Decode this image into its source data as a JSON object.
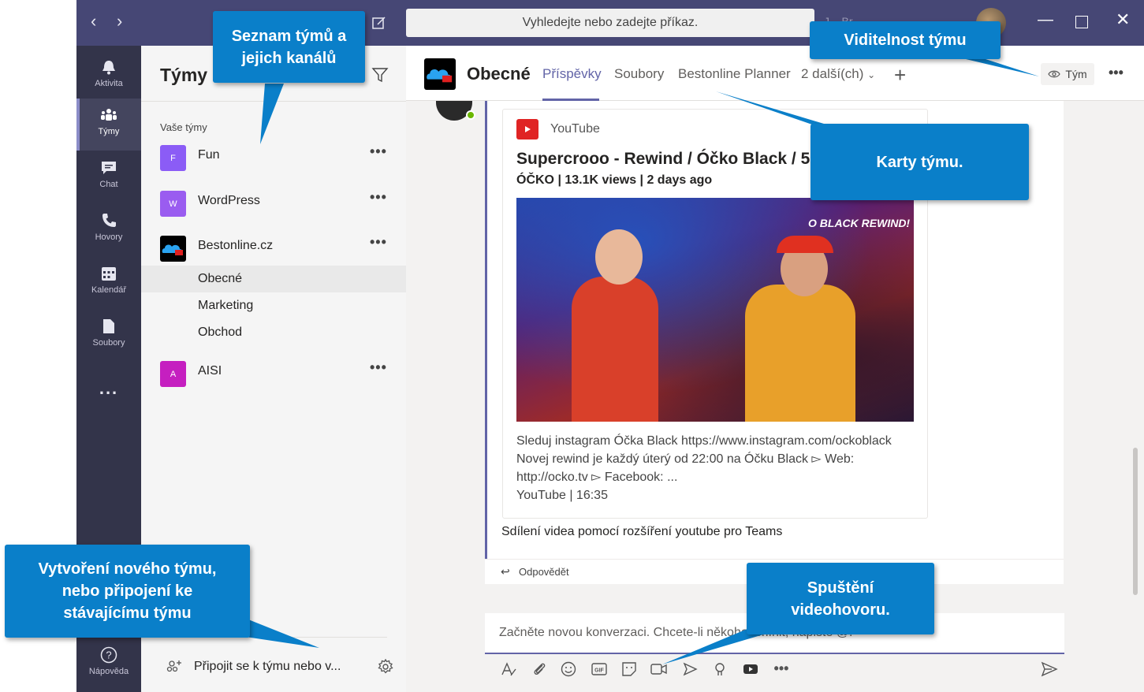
{
  "search": {
    "placeholder": "Vyhledejte nebo zadejte příkaz."
  },
  "titlebar": {
    "user_name": "J... Br..."
  },
  "rail": {
    "items": [
      {
        "label": "Aktivita",
        "icon": "bell-icon"
      },
      {
        "label": "Týmy",
        "icon": "teams-icon"
      },
      {
        "label": "Chat",
        "icon": "chat-icon"
      },
      {
        "label": "Hovory",
        "icon": "phone-icon"
      },
      {
        "label": "Kalendář",
        "icon": "calendar-icon"
      },
      {
        "label": "Soubory",
        "icon": "files-icon"
      }
    ],
    "more": "...",
    "help": "Nápověda"
  },
  "panel": {
    "title": "Týmy",
    "section": "Vaše týmy",
    "teams": [
      {
        "name": "Fun",
        "initial": "F",
        "color": "#8b5cf6"
      },
      {
        "name": "WordPress",
        "initial": "W",
        "color": "#9a5cf0"
      },
      {
        "name": "Bestonline.cz",
        "initial": "",
        "color": "#000000"
      },
      {
        "name": "AISI",
        "initial": "A",
        "color": "#c51fc0"
      }
    ],
    "channels": [
      "Obecné",
      "Marketing",
      "Obchod"
    ],
    "join": "Připojit se k týmu nebo v..."
  },
  "channel": {
    "name": "Obecné",
    "tabs": [
      "Příspěvky",
      "Soubory",
      "Bestonline Planner",
      "2 další(ch)"
    ],
    "visibility": "Tým"
  },
  "post": {
    "source": "YouTube",
    "title": "Supercrooo - Rewind / Óčko Black / 5.",
    "meta": "ÓČKO | 13.1K views | 2 days ago",
    "video_overlay": "O BLACK REWIND!",
    "desc1": "Sleduj instagram Óčka Black https://www.instagram.com/ockoblack",
    "desc2": "Novej rewind je každý úterý od 22:00 na Óčku Black ▻ Web:",
    "desc3": "http://ocko.tv ▻ Facebook: ...",
    "desc4": "YouTube | 16:35",
    "message": "Sdílení videa pomocí rozšíření youtube pro Teams",
    "reply": "Odpovědět"
  },
  "compose": {
    "placeholder": "Začněte novou konverzaci. Chcete-li někoho zmínit, napište @."
  },
  "callouts": {
    "teams_list": "Seznam týmů a jejich kanálů",
    "visibility": "Viditelnost týmu",
    "tabs": "Karty týmu.",
    "create": "Vytvoření nového týmu, nebo připojení ke stávajícímu týmu",
    "video": "Spuštění videohovoru."
  },
  "colors": {
    "accent": "#6264a7",
    "callout": "#0a7fc9",
    "rail": "#33344a",
    "topbar": "#464775"
  }
}
